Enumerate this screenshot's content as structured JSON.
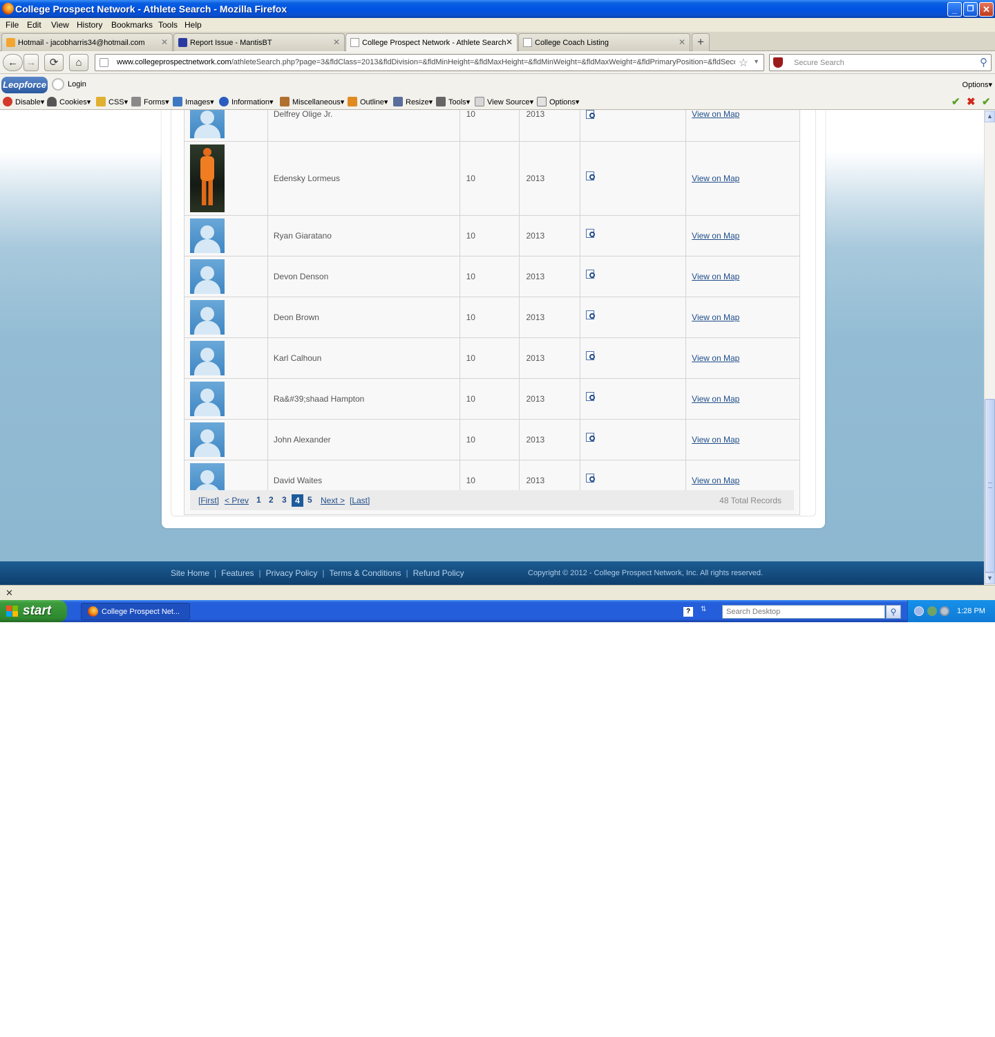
{
  "window": {
    "title": "College Prospect Network - Athlete Search - Mozilla Firefox",
    "controls": {
      "minimize": "_",
      "restore": "❐",
      "close": "✕"
    }
  },
  "menu": [
    "File",
    "Edit",
    "View",
    "History",
    "Bookmarks",
    "Tools",
    "Help"
  ],
  "tabs": [
    {
      "label": "Hotmail - jacobharris34@hotmail.com",
      "icon": "envelope-icon",
      "active": false
    },
    {
      "label": "Report Issue - MantisBT",
      "icon": "mantis-icon",
      "active": false
    },
    {
      "label": "College Prospect Network - Athlete Search",
      "icon": "page-icon",
      "active": true
    },
    {
      "label": "College Coach Listing",
      "icon": "page-icon",
      "active": false
    }
  ],
  "tab_close": "✕",
  "new_tab": "+",
  "nav": {
    "back": "←",
    "forward": "→",
    "reload": "⟳",
    "home": "⌂",
    "url_host": "www.collegeprospectnetwork.com",
    "url_path": "/athleteSearch.php?page=3&fldClass=2013&fldDivision=&fldMinHeight=&fldMaxHeight=&fldMinWeight=&fldMaxWeight=&fldPrimaryPosition=&fldSeco",
    "bookmark_star": "☆",
    "dropdown": "▼",
    "search_placeholder": "Secure Search",
    "search_icon": "⚲"
  },
  "leopforce": {
    "logo": "Leopforce",
    "login": "Login",
    "options": "Options"
  },
  "devbar": {
    "items": [
      "Disable",
      "Cookies",
      "CSS",
      "Forms",
      "Images",
      "Information",
      "Miscellaneous",
      "Outline",
      "Resize",
      "Tools",
      "View Source",
      "Options"
    ],
    "status_ok": "✔",
    "status_error": "✖"
  },
  "athletes": [
    {
      "name": "Delfrey Olige Jr.",
      "grade": "10",
      "class": "2013",
      "map": "View on Map",
      "photo": false
    },
    {
      "name": "Edensky Lormeus",
      "grade": "10",
      "class": "2013",
      "map": "View on Map",
      "photo": true
    },
    {
      "name": "Ryan Giaratano",
      "grade": "10",
      "class": "2013",
      "map": "View on Map",
      "photo": false
    },
    {
      "name": "Devon Denson",
      "grade": "10",
      "class": "2013",
      "map": "View on Map",
      "photo": false
    },
    {
      "name": "Deon Brown",
      "grade": "10",
      "class": "2013",
      "map": "View on Map",
      "photo": false
    },
    {
      "name": "Karl Calhoun",
      "grade": "10",
      "class": "2013",
      "map": "View on Map",
      "photo": false
    },
    {
      "name": "Ra&#39;shaad Hampton",
      "grade": "10",
      "class": "2013",
      "map": "View on Map",
      "photo": false
    },
    {
      "name": "John Alexander",
      "grade": "10",
      "class": "2013",
      "map": "View on Map",
      "photo": false
    },
    {
      "name": "David Waites",
      "grade": "10",
      "class": "2013",
      "map": "View on Map",
      "photo": false
    }
  ],
  "pager": {
    "first": "[First]",
    "prev": "< Prev",
    "pages": [
      "1",
      "2",
      "3",
      "4",
      "5"
    ],
    "current": "4",
    "next": "Next >",
    "last": "[Last]",
    "total": "48 Total Records"
  },
  "footer": {
    "links": [
      "Site Home",
      "Features",
      "Privacy Policy",
      "Terms & Conditions",
      "Refund Policy"
    ],
    "separator": "|",
    "copyright": "Copyright © 2012 - College Prospect Network, Inc. All rights reserved."
  },
  "findbar": {
    "close": "✕"
  },
  "taskbar": {
    "start": "start",
    "task": "College Prospect Net...",
    "help_icon": "?",
    "desktop_search_placeholder": "Search Desktop",
    "search_icon": "⚲",
    "clock": "1:28 PM"
  }
}
